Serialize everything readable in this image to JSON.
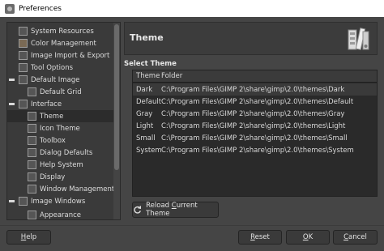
{
  "window": {
    "title": "Preferences"
  },
  "sidebar": {
    "items": [
      {
        "label": "System Resources"
      },
      {
        "label": "Color Management"
      },
      {
        "label": "Image Import & Export"
      },
      {
        "label": "Tool Options"
      },
      {
        "label": "Default Image"
      },
      {
        "label": "Default Grid"
      },
      {
        "label": "Interface"
      },
      {
        "label": "Theme"
      },
      {
        "label": "Icon Theme"
      },
      {
        "label": "Toolbox"
      },
      {
        "label": "Dialog Defaults"
      },
      {
        "label": "Help System"
      },
      {
        "label": "Display"
      },
      {
        "label": "Window Management"
      },
      {
        "label": "Image Windows"
      },
      {
        "label": "Appearance"
      }
    ]
  },
  "panel": {
    "heading": "Theme",
    "section_label": "Select Theme",
    "table": {
      "columns": [
        "Theme",
        "Folder"
      ],
      "rows": [
        {
          "theme": "Dark",
          "folder": "C:\\Program Files\\GIMP 2\\share\\gimp\\2.0\\themes\\Dark"
        },
        {
          "theme": "Default",
          "folder": "C:\\Program Files\\GIMP 2\\share\\gimp\\2.0\\themes\\Default"
        },
        {
          "theme": "Gray",
          "folder": "C:\\Program Files\\GIMP 2\\share\\gimp\\2.0\\themes\\Gray"
        },
        {
          "theme": "Light",
          "folder": "C:\\Program Files\\GIMP 2\\share\\gimp\\2.0\\themes\\Light"
        },
        {
          "theme": "Small",
          "folder": "C:\\Program Files\\GIMP 2\\share\\gimp\\2.0\\themes\\Small"
        },
        {
          "theme": "System",
          "folder": "C:\\Program Files\\GIMP 2\\share\\gimp\\2.0\\themes\\System"
        }
      ]
    },
    "reload_button": {
      "pre": "Reload ",
      "mnemonic": "C",
      "post": "urrent Theme"
    }
  },
  "buttons": {
    "help": {
      "mnemonic": "H",
      "rest": "elp"
    },
    "reset": {
      "mnemonic": "R",
      "rest": "eset"
    },
    "ok": {
      "mnemonic": "O",
      "rest": "K"
    },
    "cancel": {
      "mnemonic": "C",
      "rest": "ancel"
    }
  },
  "selected": {
    "sidebar_item": "Theme",
    "theme": "Dark"
  }
}
